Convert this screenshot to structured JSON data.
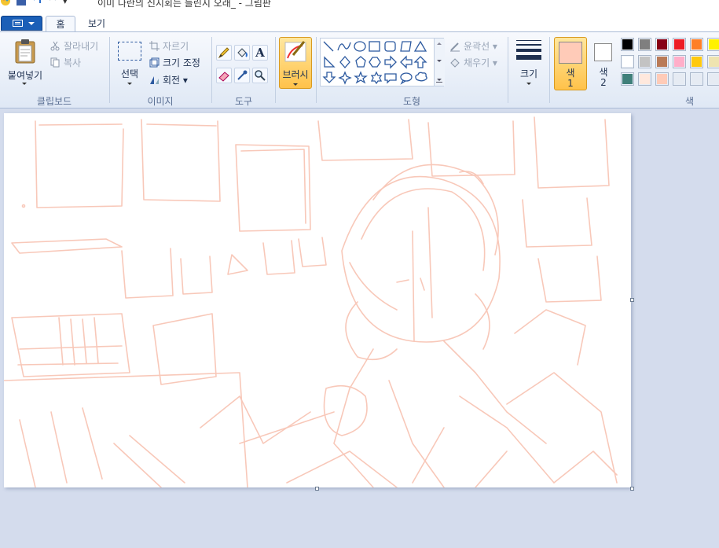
{
  "window": {
    "title": "이미 나란의 신지회는 들린지 오래_ - 그림판",
    "qat_customize": "▾"
  },
  "tabs": {
    "home": "홈",
    "view": "보기"
  },
  "clipboard": {
    "paste": "붙여넣기",
    "cut": "잘라내기",
    "copy": "복사",
    "group": "클립보드"
  },
  "image": {
    "select": "선택",
    "crop": "자르기",
    "resize": "크기 조정",
    "rotate": "회전 ▾",
    "group": "이미지"
  },
  "tools": {
    "group": "도구",
    "text_glyph": "A"
  },
  "brush": {
    "label": "브러시"
  },
  "shapes": {
    "outline": "윤곽선 ▾",
    "fill": "채우기 ▾",
    "group": "도형"
  },
  "size": {
    "label": "크기"
  },
  "colors": {
    "color1_label": "색",
    "color1_num": "1",
    "color2_label": "색",
    "color2_num": "2",
    "group": "색",
    "color1": "#ffcbb8",
    "color2": "#ffffff",
    "palette": [
      "#000000",
      "#7f7f7f",
      "#880015",
      "#ed1c24",
      "#ff7f27",
      "#fff200",
      "#ffffff",
      "#c3c3c3",
      "#b97a57",
      "#ffaec9",
      "#ffc90e",
      "#efe4b0",
      "#3f7f7a",
      "#ffe8dd",
      "#ffcbb8",
      "#e6ebf3",
      "#e6ebf3",
      "#e6ebf3"
    ]
  },
  "sketch_color": "#f6b6a2"
}
